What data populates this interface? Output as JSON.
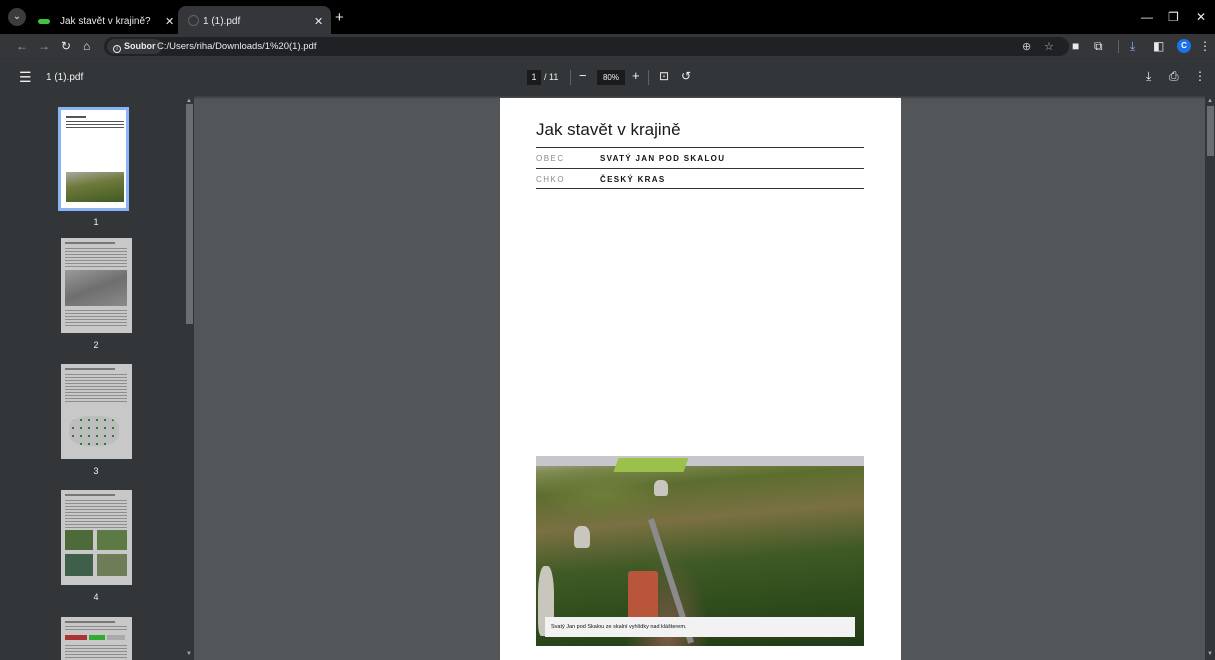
{
  "tabs": [
    {
      "title": "Jak stavět v krajině?",
      "active": false
    },
    {
      "title": "1 (1).pdf",
      "active": true
    }
  ],
  "address_bar": {
    "security_chip": "Soubor",
    "url": "C:/Users/riha/Downloads/1%20(1).pdf"
  },
  "profile_initial": "C",
  "pdf_toolbar": {
    "doc_name": "1 (1).pdf",
    "current_page": "1",
    "total_pages": "/ 11",
    "zoom": "80%"
  },
  "thumbnails": [
    {
      "label": "1",
      "selected": true
    },
    {
      "label": "2",
      "selected": false
    },
    {
      "label": "3",
      "selected": false
    },
    {
      "label": "4",
      "selected": false
    }
  ],
  "page": {
    "title": "Jak stavět v krajině",
    "meta": [
      {
        "key": "OBEC",
        "value": "SVATÝ JAN POD SKALOU"
      },
      {
        "key": "CHKO",
        "value": "ČESKÝ KRAS"
      }
    ],
    "photo_caption": "Svatý Jan pod Skalou ze skalní vyhlídky nad klášterem."
  },
  "colors": {
    "tab_favicon": "#3ec73e",
    "selection": "#8ab4f8",
    "viewer_bg": "#525659",
    "toolbar_bg": "#323639"
  }
}
